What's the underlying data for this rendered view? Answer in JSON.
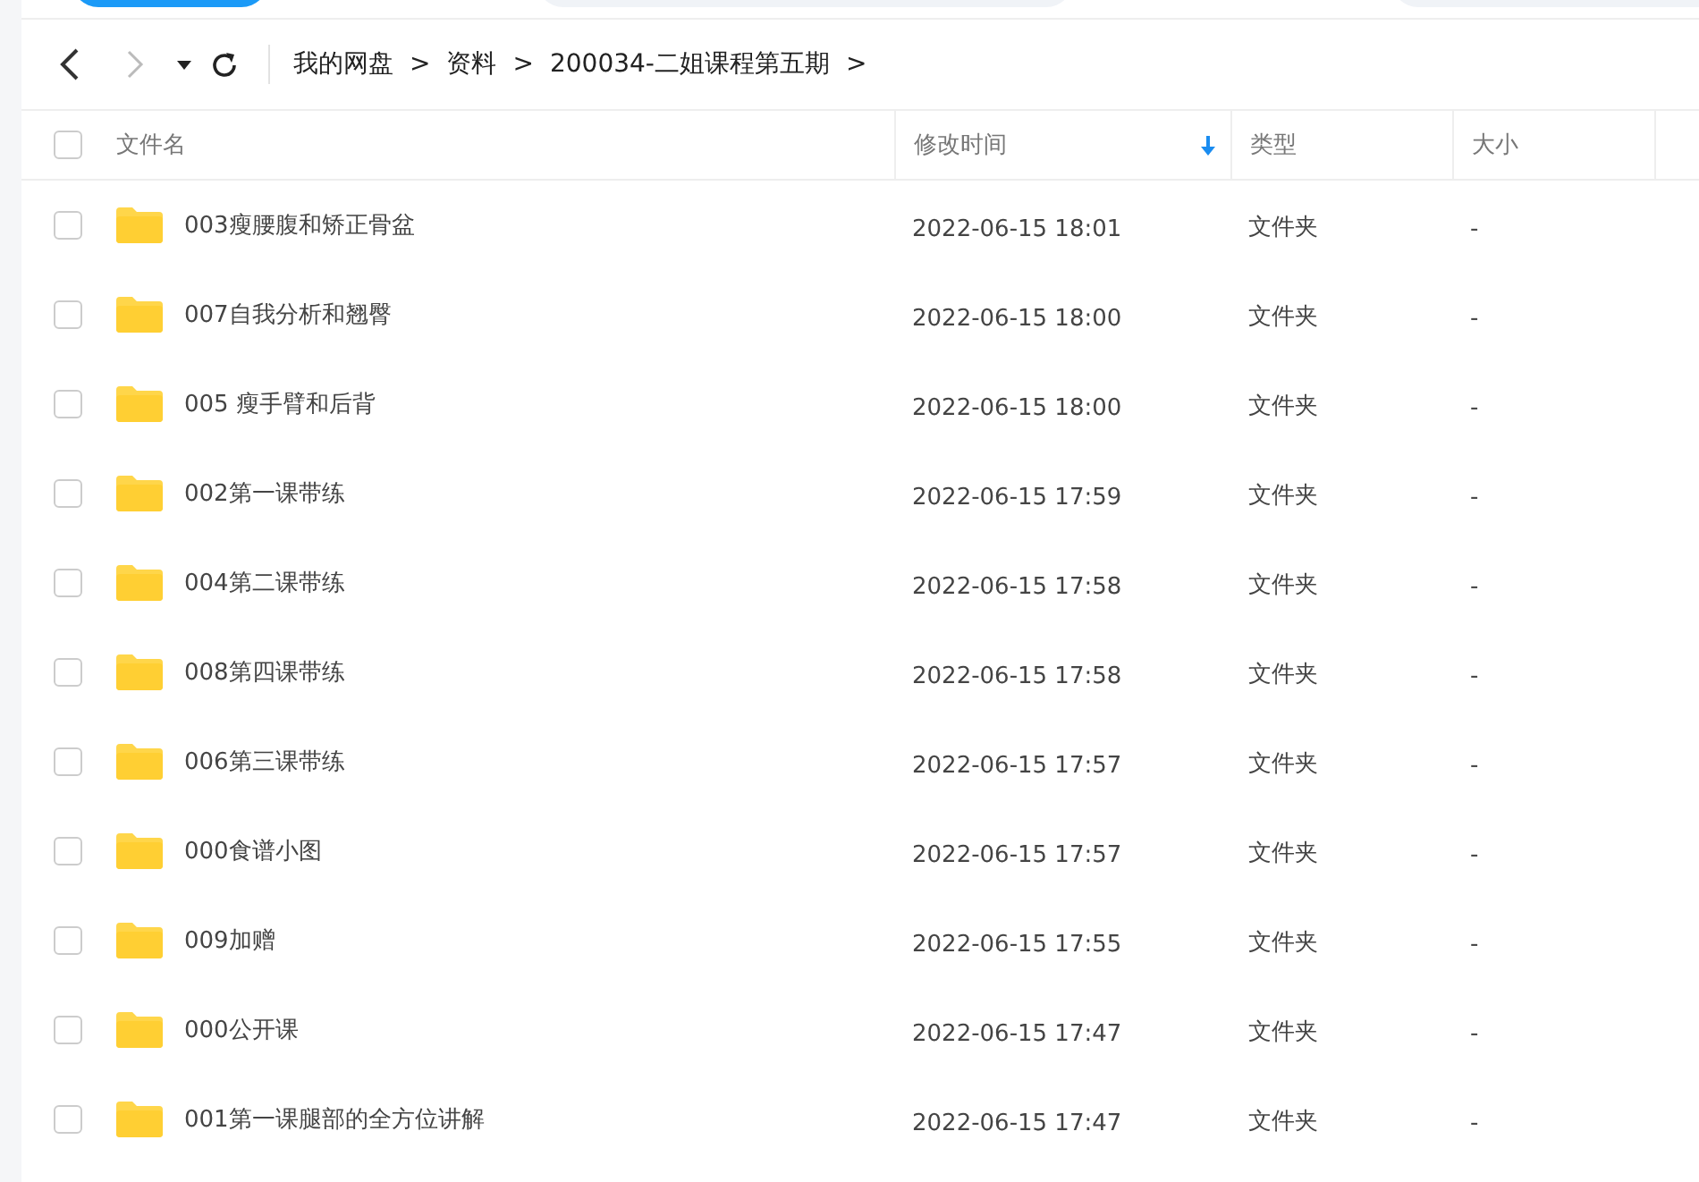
{
  "breadcrumb": [
    "我的网盘",
    "资料",
    "200034-二姐课程第五期"
  ],
  "breadcrumb_separator": ">",
  "columns": [
    {
      "label": "文件名",
      "sorted": false
    },
    {
      "label": "修改时间",
      "sorted": true
    },
    {
      "label": "类型",
      "sorted": false
    },
    {
      "label": "大小",
      "sorted": false
    }
  ],
  "select_all": {
    "checked": false
  },
  "rows": [
    {
      "name": "003瘦腰腹和矫正骨盆",
      "modified": "2022-06-15 18:01",
      "type": "文件夹",
      "size": "-",
      "checked": false
    },
    {
      "name": "007自我分析和翘臀",
      "modified": "2022-06-15 18:00",
      "type": "文件夹",
      "size": "-",
      "checked": false
    },
    {
      "name": "005 瘦手臂和后背",
      "modified": "2022-06-15 18:00",
      "type": "文件夹",
      "size": "-",
      "checked": false
    },
    {
      "name": "002第一课带练",
      "modified": "2022-06-15 17:59",
      "type": "文件夹",
      "size": "-",
      "checked": false
    },
    {
      "name": "004第二课带练",
      "modified": "2022-06-15 17:58",
      "type": "文件夹",
      "size": "-",
      "checked": false
    },
    {
      "name": "008第四课带练",
      "modified": "2022-06-15 17:58",
      "type": "文件夹",
      "size": "-",
      "checked": false
    },
    {
      "name": "006第三课带练",
      "modified": "2022-06-15 17:57",
      "type": "文件夹",
      "size": "-",
      "checked": false
    },
    {
      "name": "000食谱小图",
      "modified": "2022-06-15 17:57",
      "type": "文件夹",
      "size": "-",
      "checked": false
    },
    {
      "name": "009加赠",
      "modified": "2022-06-15 17:55",
      "type": "文件夹",
      "size": "-",
      "checked": false
    },
    {
      "name": "000公开课",
      "modified": "2022-06-15 17:47",
      "type": "文件夹",
      "size": "-",
      "checked": false
    },
    {
      "name": "001第一课腿部的全方位讲解",
      "modified": "2022-06-15 17:47",
      "type": "文件夹",
      "size": "-",
      "checked": false
    }
  ]
}
